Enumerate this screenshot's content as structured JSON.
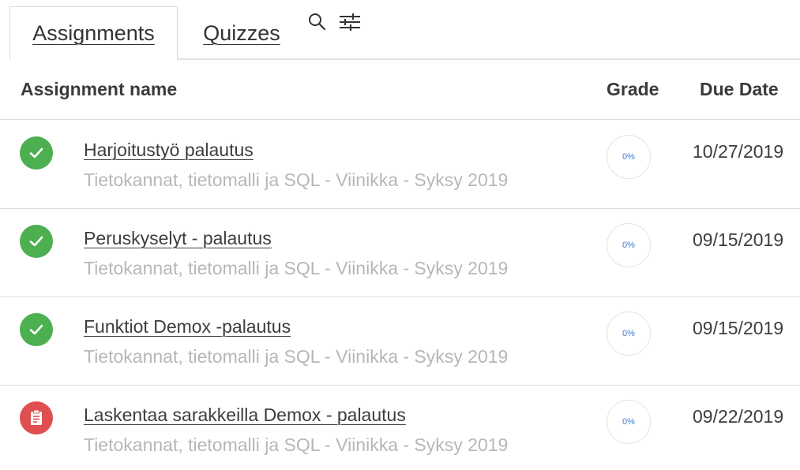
{
  "tabs": {
    "assignments_label": "Assignments",
    "quizzes_label": "Quizzes",
    "search_icon": "search-icon",
    "filter_icon": "filter-sliders-icon"
  },
  "table": {
    "headers": {
      "name": "Assignment name",
      "grade": "Grade",
      "due": "Due Date"
    },
    "rows": [
      {
        "status": "completed",
        "status_icon": "check-icon",
        "title": "Harjoitustyö palautus",
        "course": "Tietokannat, tietomalli ja SQL - Viinikka - Syksy 2019",
        "grade": "0%",
        "due": "10/27/2019"
      },
      {
        "status": "completed",
        "status_icon": "check-icon",
        "title": "Peruskyselyt - palautus",
        "course": "Tietokannat, tietomalli ja SQL - Viinikka - Syksy 2019",
        "grade": "0%",
        "due": "09/15/2019"
      },
      {
        "status": "completed",
        "status_icon": "check-icon",
        "title": "Funktiot Demox -palautus",
        "course": "Tietokannat, tietomalli ja SQL - Viinikka - Syksy 2019",
        "grade": "0%",
        "due": "09/15/2019"
      },
      {
        "status": "pending",
        "status_icon": "clipboard-icon",
        "title": "Laskentaa sarakkeilla Demox - palautus",
        "course": "Tietokannat, tietomalli ja SQL - Viinikka - Syksy 2019",
        "grade": "0%",
        "due": "09/22/2019"
      }
    ]
  },
  "colors": {
    "completed": "#4caf50",
    "pending": "#e04f4f",
    "grade_text": "#3d7bd4"
  }
}
